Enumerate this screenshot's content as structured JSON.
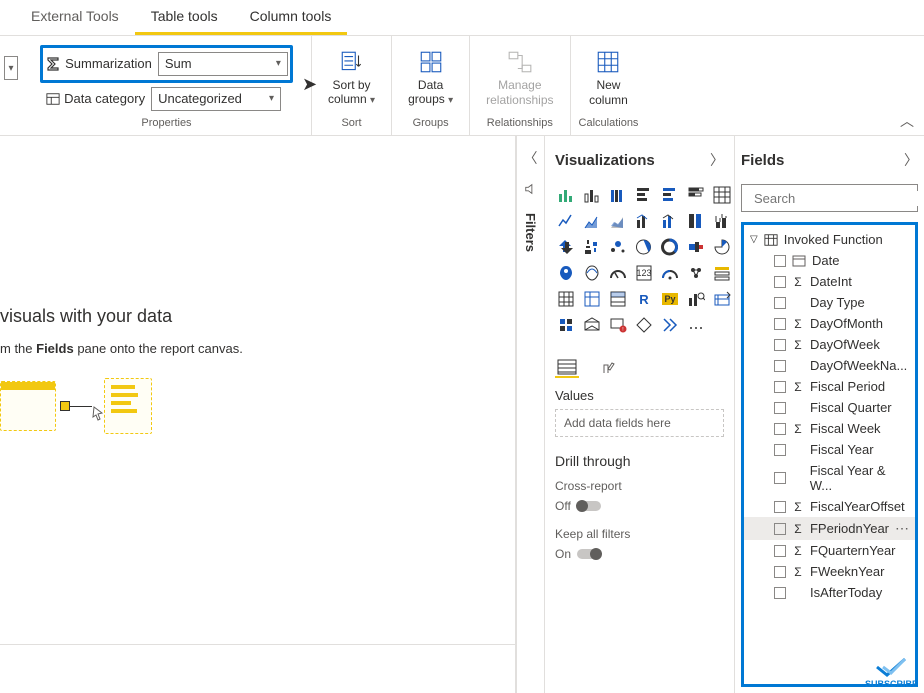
{
  "tabs": {
    "external": "External Tools",
    "table": "Table tools",
    "column": "Column tools"
  },
  "ribbon": {
    "summarization_label": "Summarization",
    "summarization_value": "Sum",
    "data_category_label": "Data category",
    "data_category_value": "Uncategorized",
    "properties_group": "Properties",
    "sort_by_column": "Sort by\ncolumn",
    "sort_group": "Sort",
    "data_groups": "Data\ngroups",
    "groups_group": "Groups",
    "manage_rel": "Manage\nrelationships",
    "relationships_group": "Relationships",
    "new_column": "New\ncolumn",
    "calculations_group": "Calculations"
  },
  "canvas": {
    "hint_title": "visuals with your data",
    "hint_body_prefix": "m the ",
    "hint_body_bold": "Fields",
    "hint_body_suffix": " pane onto the report canvas."
  },
  "filters": {
    "label": "Filters"
  },
  "viz": {
    "title": "Visualizations",
    "values_label": "Values",
    "drop_placeholder": "Add data fields here",
    "drill_title": "Drill through",
    "cross_report_label": "Cross-report",
    "off_label": "Off",
    "keep_filters_label": "Keep all filters",
    "on_label": "On"
  },
  "fields": {
    "title": "Fields",
    "search_placeholder": "Search",
    "table_name": "Invoked Function",
    "items": [
      {
        "label": "Date",
        "sigma": false,
        "dateicon": true
      },
      {
        "label": "DateInt",
        "sigma": true
      },
      {
        "label": "Day Type",
        "sigma": false
      },
      {
        "label": "DayOfMonth",
        "sigma": true
      },
      {
        "label": "DayOfWeek",
        "sigma": true
      },
      {
        "label": "DayOfWeekNa...",
        "sigma": false
      },
      {
        "label": "Fiscal Period",
        "sigma": true
      },
      {
        "label": "Fiscal Quarter",
        "sigma": false
      },
      {
        "label": "Fiscal Week",
        "sigma": true
      },
      {
        "label": "Fiscal Year",
        "sigma": false
      },
      {
        "label": "Fiscal Year & W...",
        "sigma": false
      },
      {
        "label": "FiscalYearOffset",
        "sigma": true
      },
      {
        "label": "FPeriodnYear",
        "sigma": true,
        "selected": true
      },
      {
        "label": "FQuarternYear",
        "sigma": true
      },
      {
        "label": "FWeeknYear",
        "sigma": true
      },
      {
        "label": "IsAfterToday",
        "sigma": false
      }
    ]
  },
  "subscribe": "SUBSCRIBE"
}
